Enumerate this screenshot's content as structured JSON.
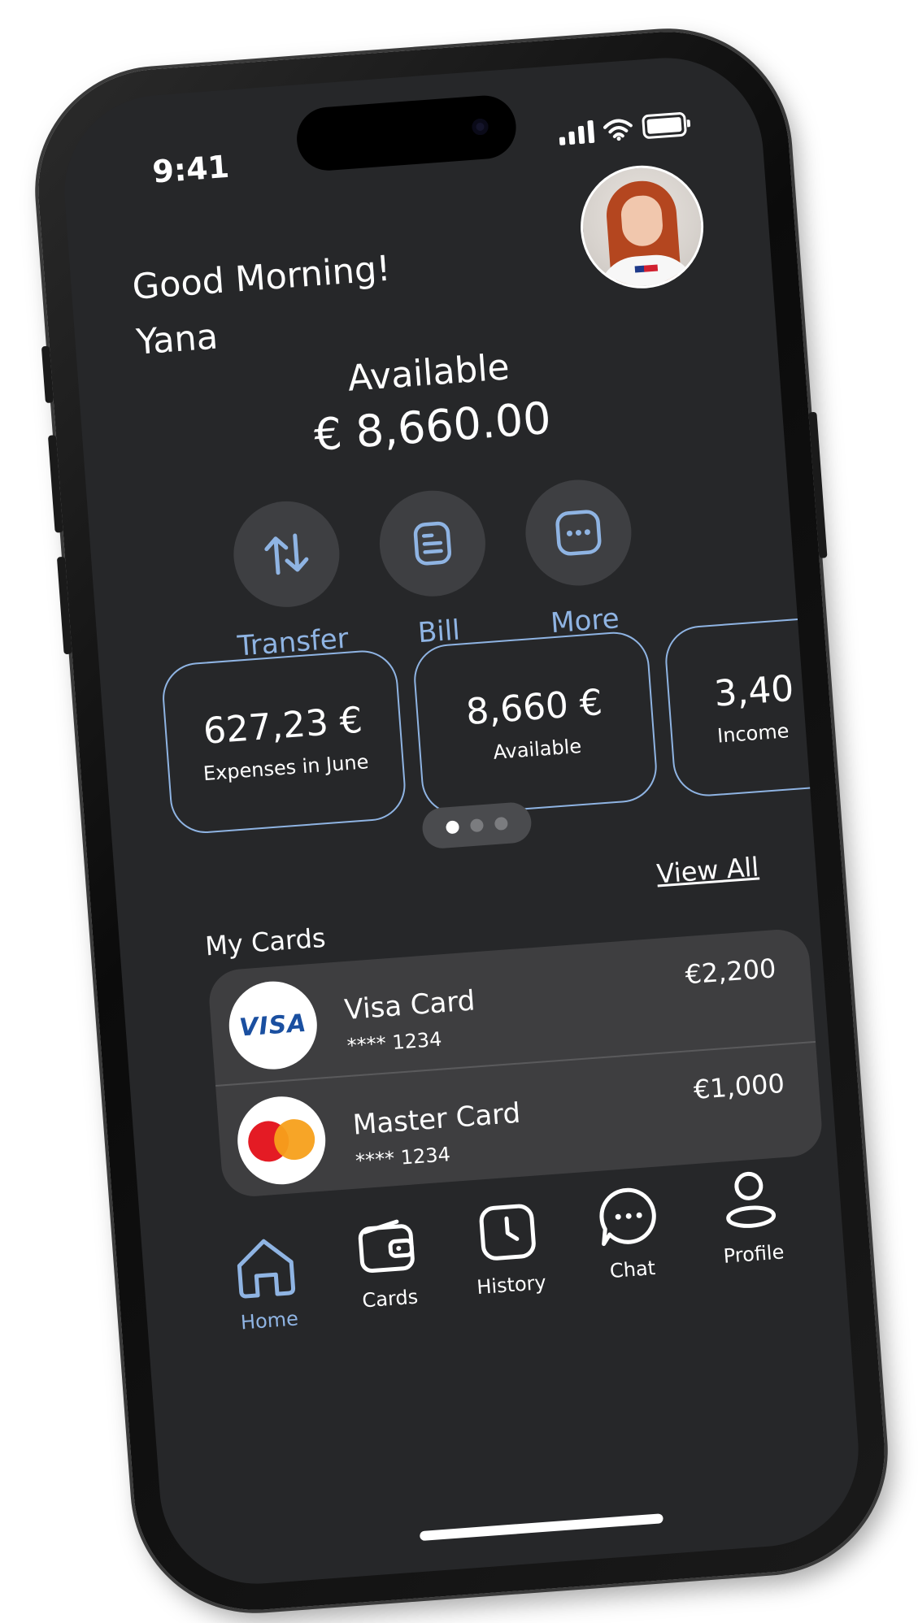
{
  "status_bar": {
    "time": "9:41"
  },
  "header": {
    "greeting": "Good Morning!",
    "name": "Yana"
  },
  "balance": {
    "label": "Available",
    "amount": "€ 8,660.00"
  },
  "actions": [
    {
      "label": "Transfer",
      "icon": "transfer-arrows-icon"
    },
    {
      "label": "Bill",
      "icon": "bill-document-icon"
    },
    {
      "label": "More",
      "icon": "more-dots-icon"
    }
  ],
  "stats": [
    {
      "value": "627,23 €",
      "caption": "Expenses in June"
    },
    {
      "value": "8,660 €",
      "caption": "Available"
    },
    {
      "value": "3,40",
      "caption": "Income"
    }
  ],
  "carousel": {
    "pages": 3,
    "active_index": 0
  },
  "cards_section": {
    "title": "My Cards",
    "view_all": "View All",
    "cards": [
      {
        "logo_text": "VISA",
        "name": "Visa Card",
        "number": "**** 1234",
        "balance": "€2,200"
      },
      {
        "logo_text": "",
        "name": "Master Card",
        "number": "**** 1234",
        "balance": "€1,000"
      }
    ]
  },
  "tabbar": {
    "items": [
      {
        "label": "Home",
        "icon": "home-icon",
        "active": true
      },
      {
        "label": "Cards",
        "icon": "wallet-icon",
        "active": false
      },
      {
        "label": "History",
        "icon": "clock-icon",
        "active": false
      },
      {
        "label": "Chat",
        "icon": "chat-bubble-icon",
        "active": false
      },
      {
        "label": "Profile",
        "icon": "user-icon",
        "active": false
      }
    ]
  },
  "colors": {
    "background": "#262729",
    "accent": "#8fb4e3",
    "surface": "#3e3e40",
    "frame": "#111111"
  }
}
